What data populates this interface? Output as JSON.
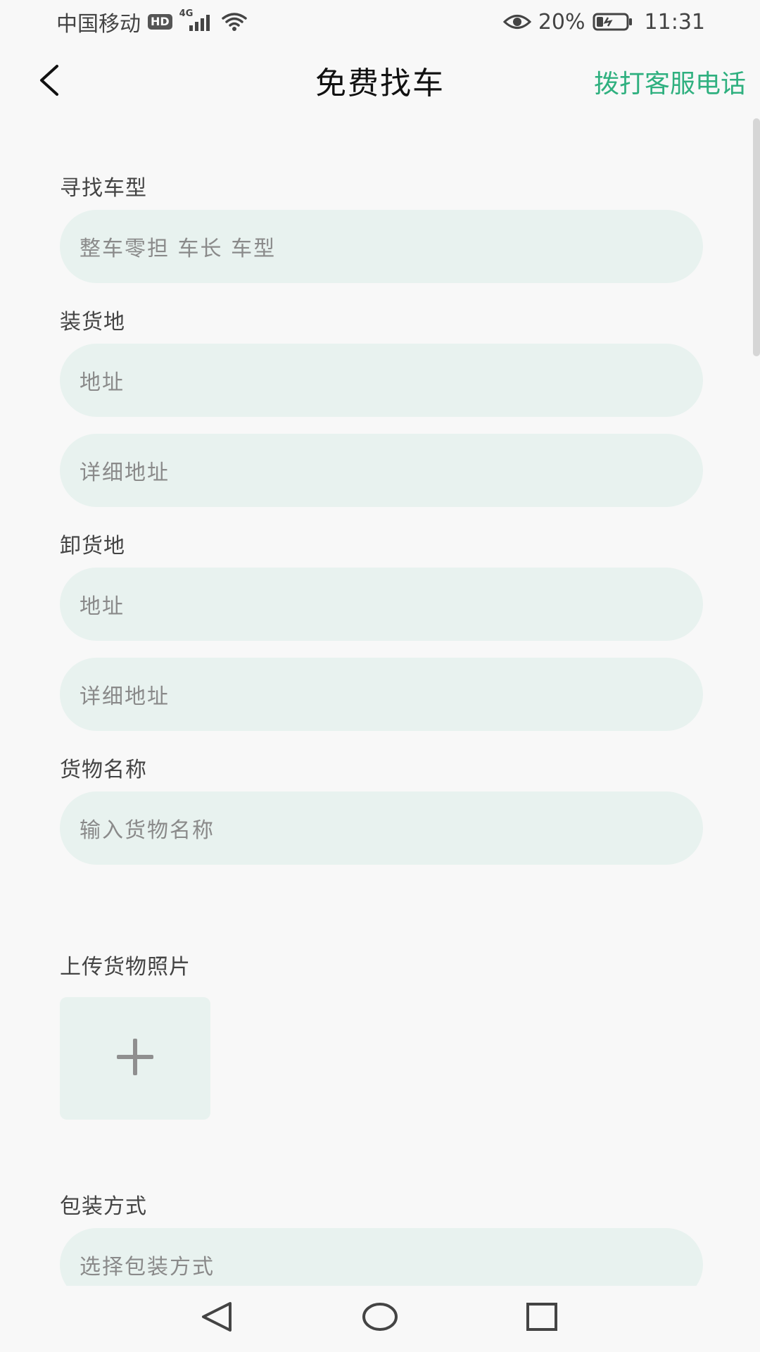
{
  "status_bar": {
    "carrier": "中国移动",
    "hd_badge": "HD",
    "network": "4G",
    "battery_percent": "20%",
    "time": "11:31"
  },
  "header": {
    "title": "免费找车",
    "call_label": "拨打客服电话"
  },
  "form": {
    "vehicle": {
      "label": "寻找车型",
      "placeholder": "整车零担 车长 车型"
    },
    "loading": {
      "label": "装货地",
      "address_placeholder": "地址",
      "detail_placeholder": "详细地址"
    },
    "unloading": {
      "label": "卸货地",
      "address_placeholder": "地址",
      "detail_placeholder": "详细地址"
    },
    "goods_name": {
      "label": "货物名称",
      "placeholder": "输入货物名称"
    },
    "photo": {
      "label": "上传货物照片"
    },
    "packaging": {
      "label": "包装方式",
      "placeholder": "选择包装方式"
    }
  },
  "colors": {
    "accent": "#2fb07f",
    "field_bg": "#e8f2ef",
    "page_bg": "#f8f8f8"
  },
  "icons": [
    "back-icon",
    "plus-icon",
    "nav-back-icon",
    "nav-home-icon",
    "nav-recents-icon",
    "wifi-icon",
    "eye-icon",
    "battery-icon",
    "signal-icon"
  ]
}
